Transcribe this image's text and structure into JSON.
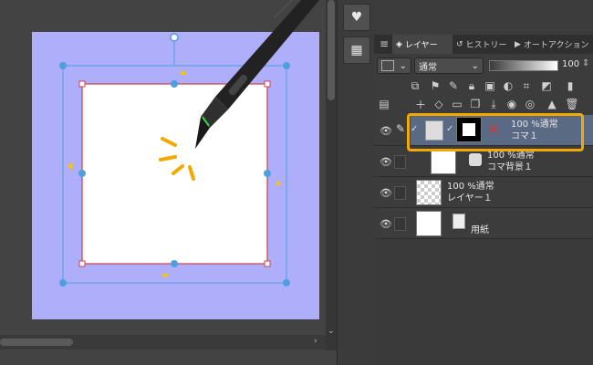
{
  "canvas": {
    "page_color": "#aeaefb",
    "frame_border_color": "#d0404a",
    "handle_color": "#4f9fe0",
    "marker_color": "#f7c600"
  },
  "rail": {
    "icons": [
      "heart-icon",
      "grid-icon"
    ]
  },
  "panel": {
    "tabs": [
      {
        "label": "レイヤー",
        "icon": "layers-icon",
        "active": true
      },
      {
        "label": "ヒストリー",
        "icon": "history-icon",
        "active": false
      },
      {
        "label": "オートアクション",
        "icon": "auto-action-icon",
        "active": false
      }
    ],
    "blend_mode": "通常",
    "opacity": "100",
    "layers": [
      {
        "name": "コマ１",
        "blend": "100 %通常",
        "selected": true,
        "kind": "frame"
      },
      {
        "name": "コマ背景１",
        "blend": "100 %通常",
        "selected": false,
        "kind": "frame-bg"
      },
      {
        "name": "レイヤー１",
        "blend": "100 %通常",
        "selected": false,
        "kind": "raster"
      },
      {
        "name": "用紙",
        "blend": "",
        "selected": false,
        "kind": "paper"
      }
    ]
  },
  "highlight_color": "#f2a900",
  "background_color": "#434343"
}
